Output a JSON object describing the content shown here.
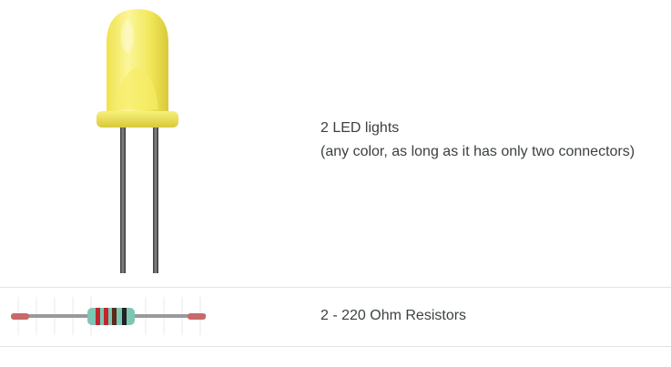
{
  "parts": [
    {
      "image": "yellow-led-photo",
      "title": "2 LED lights",
      "note": "(any color, as long as it has only two connectors)"
    },
    {
      "image": "resistor-photo",
      "title": "2 - 220 Ohm Resistors"
    }
  ],
  "colors": {
    "led_body": "#f4ee6a",
    "resistor_body": "#7cc7b4",
    "lead_tip": "#c86a6a",
    "divider": "#e3e3e3",
    "text": "#3c4043"
  }
}
